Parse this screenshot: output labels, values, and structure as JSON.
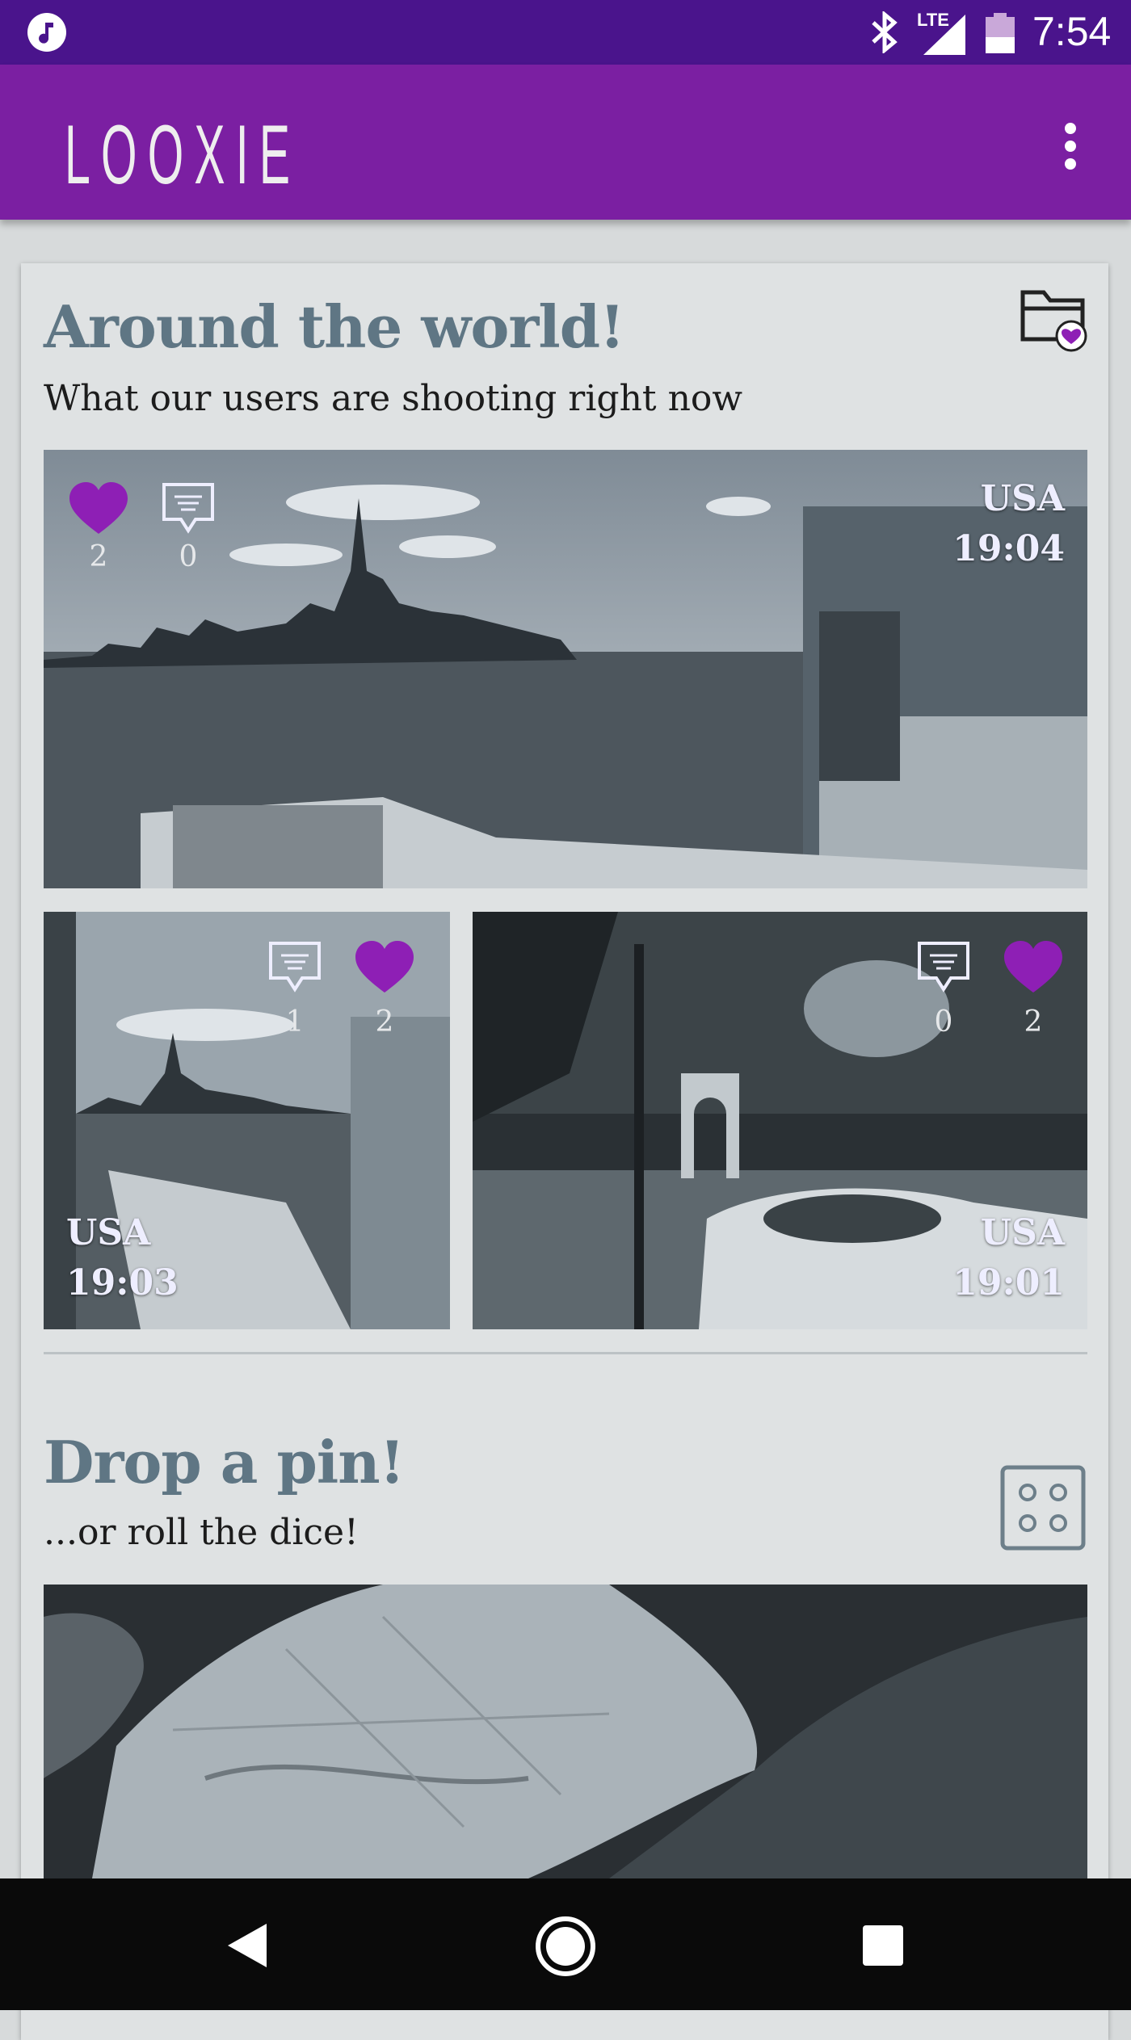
{
  "status_bar": {
    "network": "LTE",
    "time": "7:54",
    "icons": [
      "music-icon",
      "bluetooth-icon",
      "signal-icon",
      "battery-icon"
    ]
  },
  "app_bar": {
    "logo": "LOOXIE",
    "menu_icon": "more-vert-icon"
  },
  "colors": {
    "status_bar": "#4a148c",
    "app_bar": "#7b1fa2",
    "accent_heart": "#8e1fb5",
    "heading": "#5f7684"
  },
  "around_the_world": {
    "title": "Around the world!",
    "subtitle": "What our users are shooting right now",
    "favorites_icon": "folder-heart-icon",
    "shots": [
      {
        "likes": "2",
        "comments": "0",
        "country": "USA",
        "time": "19:04"
      },
      {
        "likes": "2",
        "comments": "1",
        "country": "USA",
        "time": "19:03"
      },
      {
        "likes": "2",
        "comments": "0",
        "country": "USA",
        "time": "19:01"
      }
    ]
  },
  "drop_a_pin": {
    "title": "Drop a pin!",
    "subtitle": "...or roll the dice!",
    "dice_icon": "dice-icon"
  },
  "nav_bar": {
    "back": "back-icon",
    "home": "home-icon",
    "recents": "recents-icon"
  }
}
